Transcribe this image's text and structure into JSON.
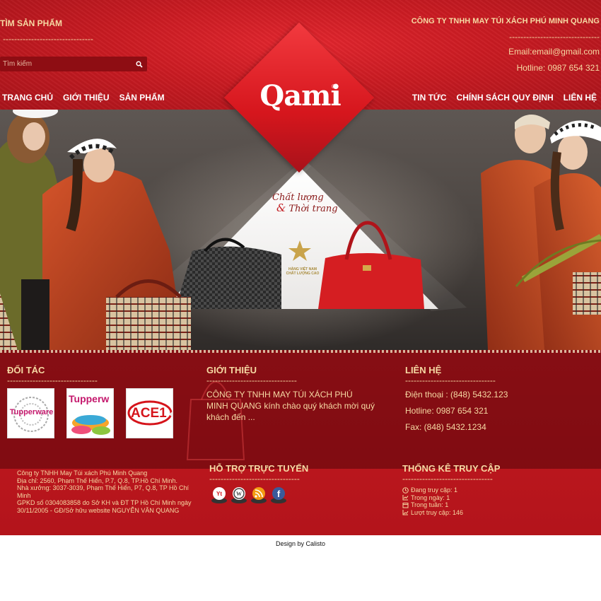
{
  "header": {
    "search_title": "TÌM SẢN PHẨM",
    "dash": "--------------------------------",
    "search_placeholder": "Tìm kiếm",
    "company": "CÔNG TY TNHH MAY TÚI XÁCH PHÚ MINH QUANG",
    "email": "Email:email@gmail.com",
    "hotline": "Hotline: 0987 654 321"
  },
  "logo": {
    "text": "Qami",
    "mark": "®"
  },
  "nav": {
    "left": [
      "TRANG CHỦ",
      "GIỚI THIỆU",
      "SẢN PHẨM"
    ],
    "right": [
      "TIN TỨC",
      "CHÍNH SÁCH QUY ĐỊNH",
      "LIÊN HỆ"
    ]
  },
  "banner": {
    "slogan_1": "Chất lượng",
    "slogan_amp": "&",
    "slogan_2": "Thời trang",
    "badge_1": "HÀNG VIỆT NAM",
    "badge_2": "CHẤT LƯỢNG CAO"
  },
  "footer": {
    "dash": "--------------------------------",
    "partners": {
      "heading": "ĐỐI TÁC",
      "logos": [
        "Tupperware",
        "Tupperw",
        "ACE1"
      ]
    },
    "intro": {
      "heading": "GIỚI THIỆU",
      "text": "CÔNG TY TNHH MAY TÚI XÁCH PHÚ MINH QUANG kính chào quý khách mời quý khách đến ..."
    },
    "contact": {
      "heading": "LIÊN HỆ",
      "phone": "Điện thoại : (848) 5432.123",
      "hotline": "Hotline: 0987 654 321",
      "fax": "Fax: (848) 5432.1234"
    },
    "address": {
      "line1": "Công ty TNHH May Túi xách Phú Minh Quang",
      "line2": "Địa chỉ: 2560, Phạm Thế Hiển, P.7, Q.8, TP.Hồ Chí Minh.",
      "line3": "Nhà xưởng: 3037-3039, Phạm Thế Hiển, P7, Q.8, TP Hồ Chí Minh",
      "line4": "GPKD số 0304083858 do Sở KH và ĐT TP Hồ Chí Minh ngày 30/11/2005 - GĐ/Sở hữu website NGUYỄN VĂN QUANG"
    },
    "support": {
      "heading": "HỖ TRỢ TRỰC TUYẾN"
    },
    "stats": {
      "heading": "THỐNG KÊ TRUY CẬP",
      "online": "Đang truy cập: 1",
      "today": "Trong ngày: 1",
      "week": "Trong tuần: 1",
      "total": "Lượt truy cập: 146"
    }
  },
  "credit": "Design by  Calisto",
  "colors": {
    "header_red": "#c91b22",
    "gold_text": "#f6d9a3",
    "dark_red": "#8e0d13"
  },
  "icons": [
    "search-icon",
    "youtube-icon",
    "wordpress-icon",
    "rss-icon",
    "facebook-icon",
    "clock-icon",
    "chart-icon",
    "calendar-icon",
    "graph-icon"
  ]
}
